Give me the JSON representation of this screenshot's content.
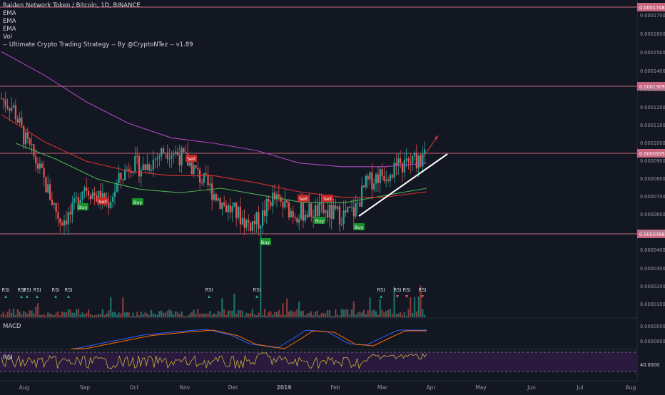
{
  "header": {
    "title": "Raiden Network Token / Bitcoin, 1D, BINANCE",
    "indicators": [
      "EMA",
      "EMA",
      "EMA",
      "Vol",
      "-- Ultimate Crypto Trading Strategy -- By @CryptoNTez -- v1.89"
    ]
  },
  "colors": {
    "background": "#131722",
    "up": "#26a69a",
    "down": "#ef5350",
    "ema_short": "#4caf50",
    "ema_mid": "#d32f2f",
    "ema_long": "#ab47bc",
    "hline": "#c8667f",
    "buy": "#1b8f2e",
    "sell": "#c62828",
    "rsi_line": "#c9b53a",
    "rsi_band": "#2a1a3d"
  },
  "chart_data": {
    "type": "candlestick",
    "title": "Raiden Network Token / Bitcoin, 1D, BINANCE",
    "x_axis": {
      "tick_labels": [
        "Aug",
        "Sep",
        "Oct",
        "Nov",
        "Dec",
        "2019",
        "Feb",
        "Mar",
        "Apr",
        "May",
        "Jun",
        "Jul",
        "Aug"
      ]
    },
    "y_axis": {
      "scale": "linear",
      "range": [
        5e-07,
        1.77e-05
      ],
      "tick_labels": [
        "0.00017000",
        "0.00016000",
        "0.00015000",
        "0.00014000",
        "0.00013000",
        "0.00012000",
        "0.00011000",
        "0.00010000",
        "0.00009000",
        "0.00008000",
        "0.00007000",
        "0.00006000",
        "0.00005000",
        "0.00004000",
        "0.00003000",
        "0.00002000",
        "0.00001000"
      ]
    },
    "horizontal_levels": [
      "0.00017482",
      "0.00013096",
      "0.00009356",
      "0.00004863"
    ],
    "price_path": [
      [
        "Jul 20",
        0.000124
      ],
      [
        "Jul 27",
        0.000119
      ],
      [
        "Aug 3",
        0.000101
      ],
      [
        "Aug 10",
        8.8e-05
      ],
      [
        "Aug 17",
        7.2e-05
      ],
      [
        "Aug 24",
        5.6e-05
      ],
      [
        "Aug 31",
        6e-05
      ],
      [
        "Sep 7",
        7.6e-05
      ],
      [
        "Sep 14",
        7e-05
      ],
      [
        "Sep 21",
        6.5e-05
      ],
      [
        "Sep 28",
        7.8e-05
      ],
      [
        "Oct 5",
        8.8e-05
      ],
      [
        "Oct 12",
        8.5e-05
      ],
      [
        "Oct 19",
        9e-05
      ],
      [
        "Oct 26",
        9.6e-05
      ],
      [
        "Nov 2",
        9.3e-05
      ],
      [
        "Nov 9",
        8.8e-05
      ],
      [
        "Nov 16",
        7.9e-05
      ],
      [
        "Nov 23",
        7.2e-05
      ],
      [
        "Nov 30",
        6.4e-05
      ],
      [
        "Dec 7",
        6e-05
      ],
      [
        "Dec 14",
        5.4e-05
      ],
      [
        "Dec 21",
        5.6e-05
      ],
      [
        "Dec 28",
        6.9e-05
      ],
      [
        "Jan 4",
        6.4e-05
      ],
      [
        "Jan 11",
        6e-05
      ],
      [
        "Jan 18",
        6.1e-05
      ],
      [
        "Jan 25",
        6.1e-05
      ],
      [
        "Feb 1",
        6e-05
      ],
      [
        "Feb 8",
        5.9e-05
      ],
      [
        "Feb 15",
        6.1e-05
      ],
      [
        "Feb 22",
        7.6e-05
      ],
      [
        "Mar 1",
        8.1e-05
      ],
      [
        "Mar 8",
        8.3e-05
      ],
      [
        "Mar 15",
        8.6e-05
      ],
      [
        "Mar 22",
        8.9e-05
      ],
      [
        "Mar 29",
        9.1e-05
      ]
    ],
    "series": [
      {
        "values": [
          [
            0.0,
            9.9e-05
          ],
          [
            0.1,
            9e-05
          ],
          [
            0.2,
            7.9e-05
          ],
          [
            0.3,
            7.35e-05
          ],
          [
            0.4,
            7.15e-05
          ],
          [
            0.5,
            7.4e-05
          ],
          [
            0.6,
            7e-05
          ],
          [
            0.7,
            6.6e-05
          ],
          [
            0.8,
            6.6e-05
          ],
          [
            0.9,
            7e-05
          ],
          [
            1.0,
            7.4e-05
          ]
        ]
      },
      {
        "values": [
          [
            0.0,
            0.000115
          ],
          [
            0.1,
            0.0001
          ],
          [
            0.2,
            8.9e-05
          ],
          [
            0.3,
            8.35e-05
          ],
          [
            0.4,
            8.1e-05
          ],
          [
            0.5,
            8.1e-05
          ],
          [
            0.6,
            7.7e-05
          ],
          [
            0.7,
            7.2e-05
          ],
          [
            0.8,
            6.9e-05
          ],
          [
            0.9,
            6.9e-05
          ],
          [
            1.0,
            7.2e-05
          ]
        ]
      },
      {
        "values": [
          [
            0.0,
            0.00015
          ],
          [
            0.1,
            0.000137
          ],
          [
            0.2,
            0.000122
          ],
          [
            0.3,
            0.00011
          ],
          [
            0.4,
            0.000102
          ],
          [
            0.5,
            9.9e-05
          ],
          [
            0.6,
            9.5e-05
          ],
          [
            0.7,
            8.8e-05
          ],
          [
            0.8,
            8.6e-05
          ],
          [
            0.9,
            8.6e-05
          ],
          [
            1.0,
            8.8e-05
          ]
        ]
      }
    ],
    "signals": [
      {
        "label": "Buy",
        "date": "Aug 30"
      },
      {
        "label": "Sell",
        "date": "Sep 12"
      },
      {
        "label": "Buy",
        "date": "Sep 28"
      },
      {
        "label": "Sell",
        "date": "Nov 4"
      },
      {
        "label": "Buy",
        "date": "Dec 18"
      },
      {
        "label": "Sell",
        "date": "Jan 15"
      },
      {
        "label": "Sell",
        "date": "Jan 31"
      },
      {
        "label": "Buy",
        "date": "Jan 23"
      },
      {
        "label": "Buy",
        "date": "Feb 19"
      }
    ],
    "rsi_markers": [
      {
        "label": "RSI",
        "dir": "up"
      },
      {
        "label": "RSI",
        "dir": "up"
      },
      {
        "label": "RSI",
        "dir": "up"
      },
      {
        "label": "RSI",
        "dir": "up"
      },
      {
        "label": "RSI",
        "dir": "up"
      },
      {
        "label": "RSI",
        "dir": "up"
      },
      {
        "label": "RSI",
        "dir": "up"
      },
      {
        "label": "RSI",
        "dir": "up"
      },
      {
        "label": "RSI",
        "dir": "up"
      },
      {
        "label": "RSI",
        "dir": "down"
      },
      {
        "label": "RSI",
        "dir": "down"
      },
      {
        "label": "RSI",
        "dir": "down"
      },
      {
        "label": "RSI",
        "dir": "down"
      }
    ],
    "panels": {
      "macd": {
        "label": "MACD",
        "tick_labels": [
          "0.00000500",
          "0.00000000"
        ]
      },
      "rsi": {
        "label": "RSI",
        "tick_labels": [
          "40.0000"
        ]
      }
    }
  }
}
